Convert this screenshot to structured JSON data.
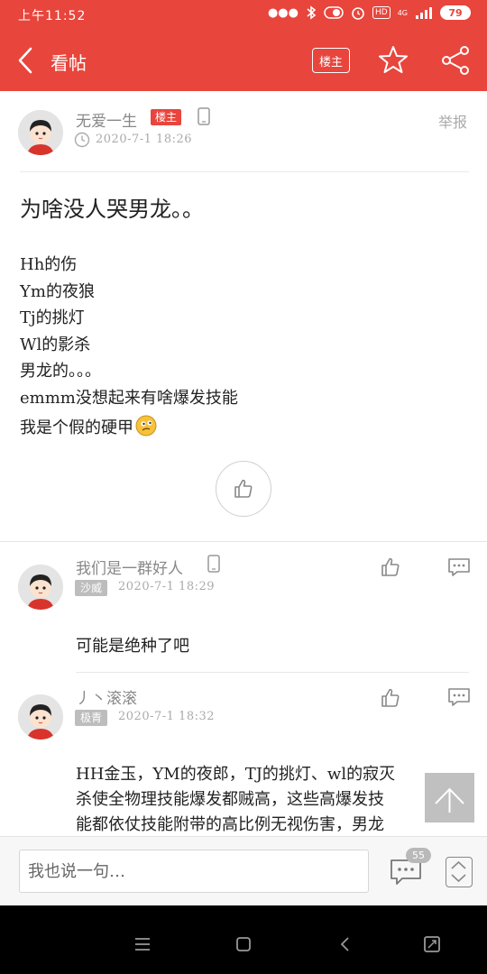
{
  "status_bar": {
    "time": "上午11:52",
    "signal": "4G",
    "battery": "79",
    "hd_label": "HD"
  },
  "nav": {
    "title": "看帖",
    "owner_button": "楼主",
    "icons": [
      "back-arrow-icon",
      "star-icon",
      "share-icon"
    ]
  },
  "post": {
    "author": "无爱一生",
    "author_badge": "楼主",
    "time": "2020-7-1  18:26",
    "report": "举报",
    "title": "为啥没人哭男龙。。",
    "lines": [
      "Hh的伤",
      "Ym的夜狼",
      "Tj的挑灯",
      "Wl的影杀",
      "男龙的。。。",
      "emmm没想起来有啥爆发技能",
      "我是个假的硬甲"
    ]
  },
  "comments": [
    {
      "author": "我们是一群好人",
      "tag": "沙威",
      "time": "2020-7-1  18:29",
      "text": "可能是绝种了吧"
    },
    {
      "author": "丿丶滚滚",
      "tag": "极青",
      "time": "2020-7-1  18:32",
      "lines": [
        "HH金玉，YM的夜郎，TJ的挑灯、wl的寂灭",
        "杀使全物理技能爆发都贼高，这些高爆发技",
        "能都依仗技能附带的高比例无视伤害，男龙"
      ]
    }
  ],
  "bottom_bar": {
    "input_placeholder": "我也说一句…",
    "comment_count": "55"
  },
  "colors": {
    "brand_red": "#e8453c",
    "tag_gray": "#bdbdbd"
  }
}
